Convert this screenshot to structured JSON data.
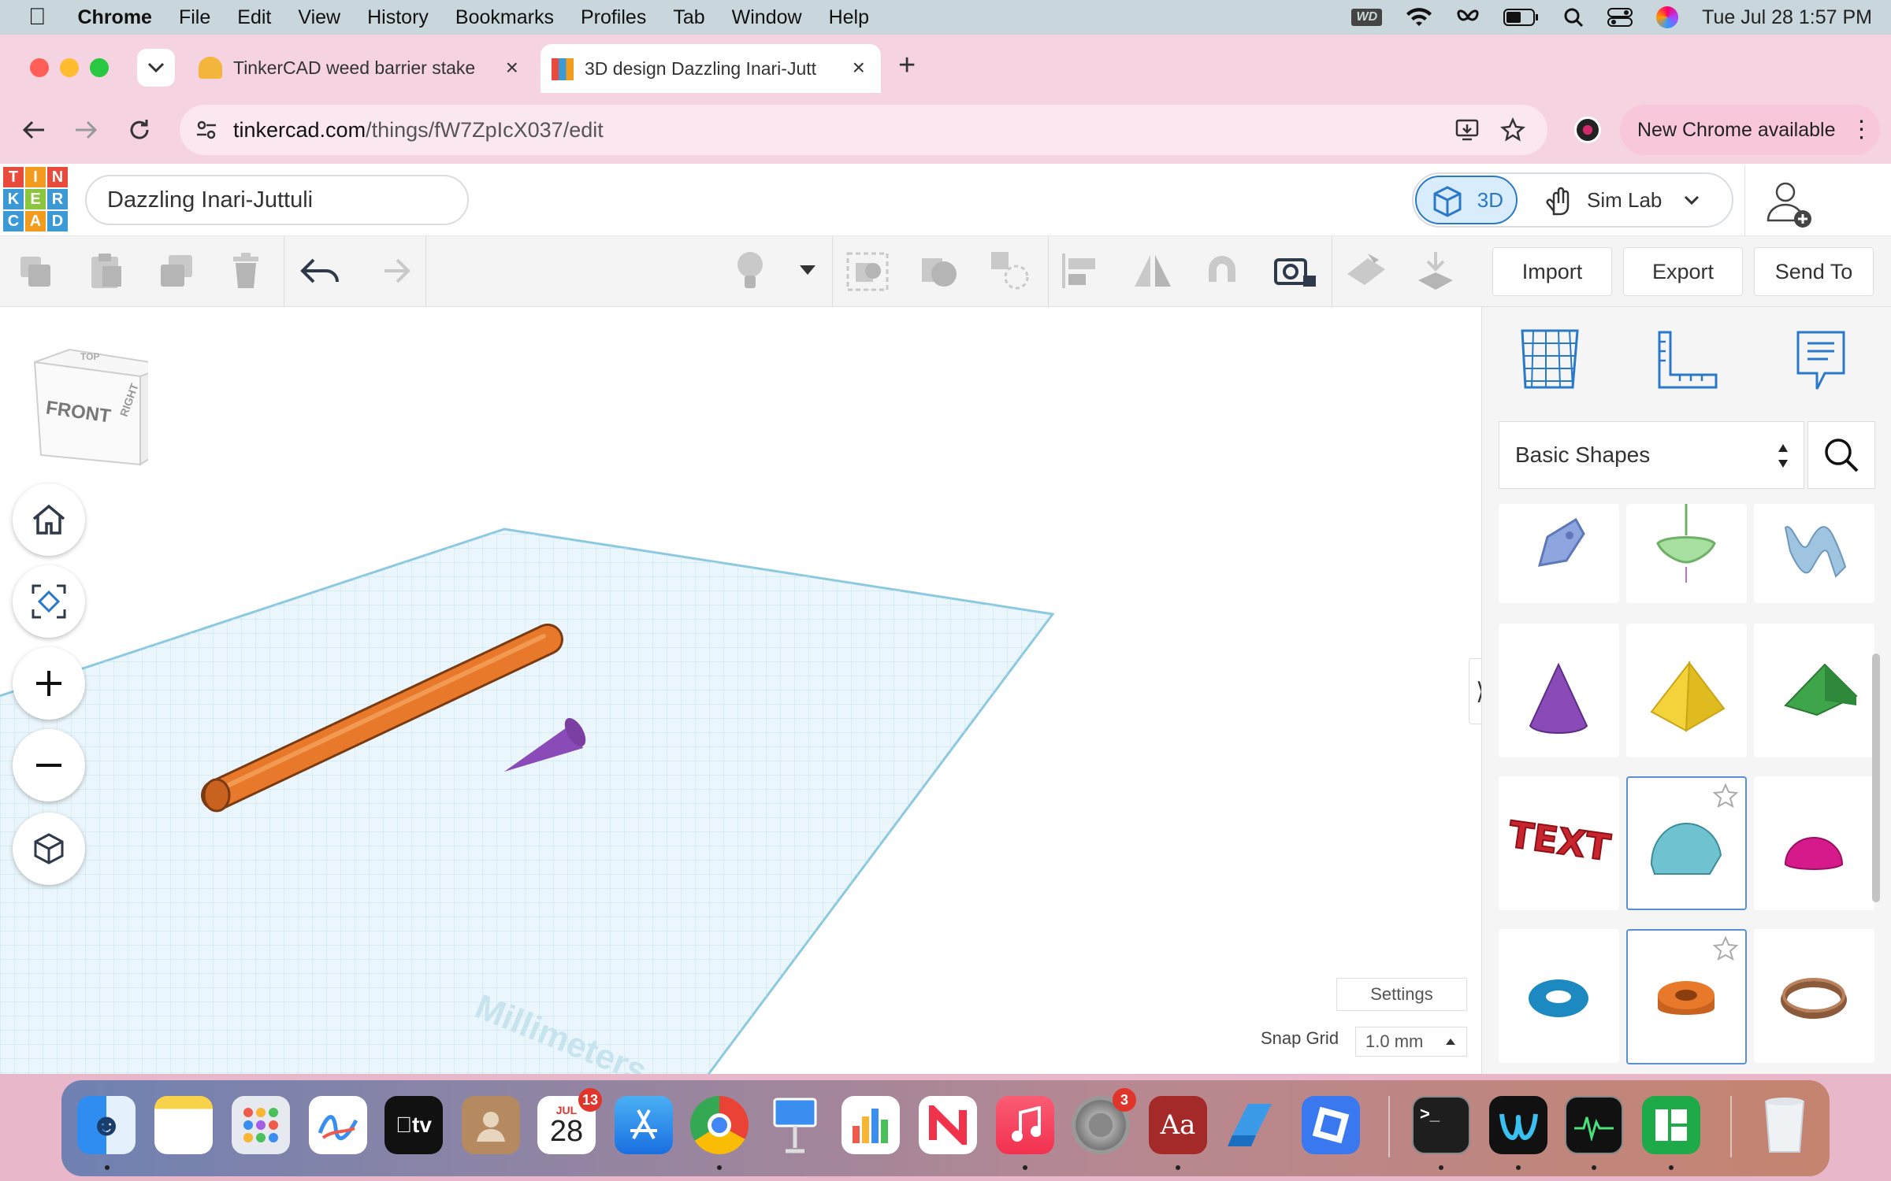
{
  "menubar": {
    "app": "Chrome",
    "items": [
      "File",
      "Edit",
      "View",
      "History",
      "Bookmarks",
      "Profiles",
      "Tab",
      "Window",
      "Help"
    ],
    "wd_label": "WD",
    "datetime": "Tue Jul 28  1:57 PM"
  },
  "tabs": [
    {
      "title": "TinkerCAD weed barrier stake"
    },
    {
      "title": "3D design Dazzling Inari-Jutt"
    }
  ],
  "omnibox": {
    "url_domain": "tinkercad.com",
    "url_path": "/things/fW7ZpIcX037/edit"
  },
  "update_button": {
    "label": "New Chrome available"
  },
  "tinkercad": {
    "logo": [
      "T",
      "I",
      "N",
      "K",
      "E",
      "R",
      "C",
      "A",
      "D"
    ],
    "design_title": "Dazzling Inari-Juttuli",
    "mode_3d": "3D",
    "mode_simlab": "Sim Lab",
    "import_label": "Import",
    "export_label": "Export",
    "sendto_label": "Send To",
    "viewcube": {
      "front": "FRONT",
      "right": "RIGHT",
      "top": "TOP"
    },
    "grid_label": "Millimeters",
    "shape_category": "Basic Shapes",
    "settings_label": "Settings",
    "snap_grid_label": "Snap Grid",
    "snap_grid_value": "1.0 mm",
    "text_shape_label": "TEXT"
  },
  "dock": {
    "calendar_month": "JUL",
    "calendar_day": "28",
    "calendar_badge": "13",
    "settings_badge": "3",
    "dictionary_label": "Aa",
    "terminal_label": ">_"
  },
  "colors": {
    "cylinder": "#e8782a",
    "cone": "#7a3fa0",
    "grid": "#a8d8ea",
    "accent": "#2a79c9"
  }
}
